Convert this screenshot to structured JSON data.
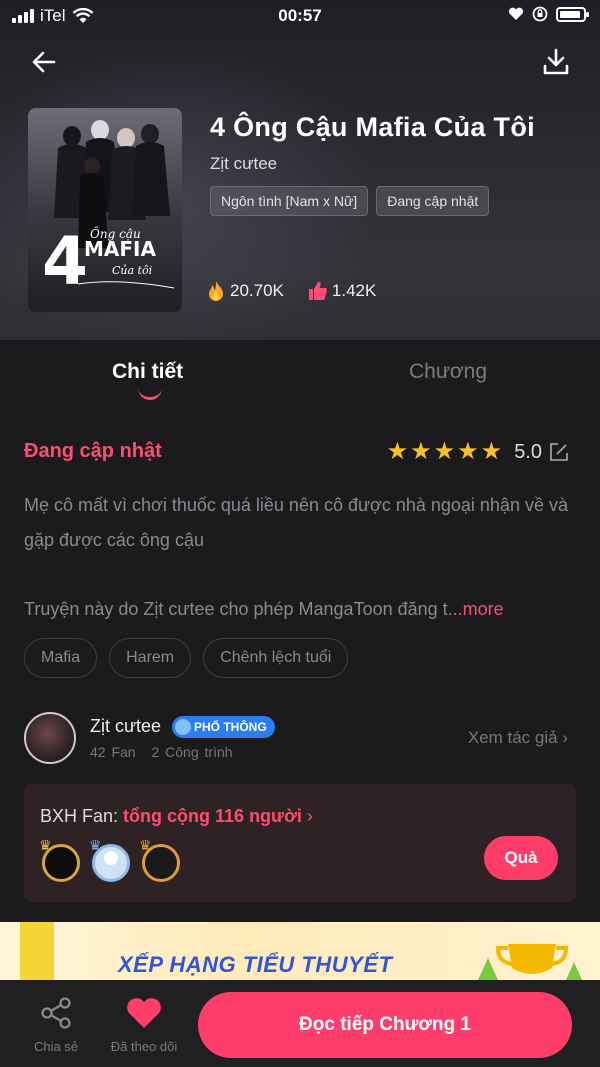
{
  "status_bar": {
    "carrier": "iTel",
    "time": "00:57"
  },
  "book": {
    "title": "4 Ông Cậu Mafia Của Tôi",
    "author": "Zịt cưtee",
    "tags": [
      "Ngôn tình [Nam x Nữ]",
      "Đang cập nhật"
    ],
    "views": "20.70K",
    "likes": "1.42K",
    "cover_text": {
      "number": "4",
      "line1": "Ông cậu",
      "line2": "MAFIA",
      "line3": "Của tôi"
    }
  },
  "tabs": {
    "detail": "Chi tiết",
    "chapters": "Chương"
  },
  "details": {
    "status": "Đang cập nhật",
    "rating": "5.0",
    "stars": 5,
    "description": "Mẹ cô mất vì chơi thuốc quá liều nên cô được nhà ngoại nhận về và gặp được các ông cậu",
    "permission_text": "Truyện này do Zịt cưtee cho phép MangaToon đăng t",
    "more_label": "...more",
    "genres": [
      "Mafia",
      "Harem",
      "Chênh lệch tuổi"
    ]
  },
  "author_row": {
    "name": "Zịt cưtee",
    "badge": "PHỔ THÔNG",
    "fans": "42 Fan",
    "works": "2 Công trình",
    "view_author": "Xem tác giả"
  },
  "fan_ranking": {
    "label": "BXH Fan:",
    "total": "tổng cộng 116 người",
    "gift_button": "Quà"
  },
  "banner": {
    "text": "XẾP HẠNG TIỂU THUYẾT"
  },
  "bottom_bar": {
    "share": "Chia sẻ",
    "follow": "Đã theo dõi",
    "read": "Đọc tiếp Chương 1"
  },
  "colors": {
    "accent": "#ff3d6b",
    "star": "#f5c22c",
    "badge": "#2c7ef0"
  }
}
